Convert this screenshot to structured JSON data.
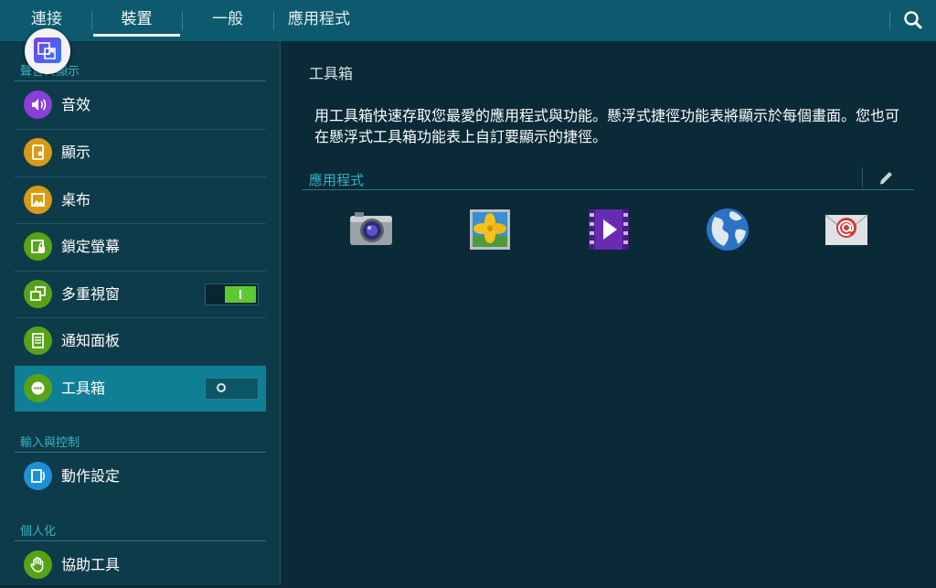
{
  "tabs": [
    {
      "label": "連接"
    },
    {
      "label": "裝置"
    },
    {
      "label": "一般"
    },
    {
      "label": "應用程式"
    }
  ],
  "active_tab": "裝置",
  "sections": [
    {
      "header": "聲音與顯示",
      "items": [
        {
          "label": "音效",
          "icon": "sound-icon",
          "color": "#8a3fd8"
        },
        {
          "label": "顯示",
          "icon": "display-icon",
          "color": "#d99a14"
        },
        {
          "label": "桌布",
          "icon": "wallpaper-icon",
          "color": "#d99a14"
        },
        {
          "label": "鎖定螢幕",
          "icon": "lock-screen-icon",
          "color": "#56a318"
        },
        {
          "label": "多重視窗",
          "icon": "multi-window-icon",
          "color": "#56a318",
          "toggle": "on"
        },
        {
          "label": "通知面板",
          "icon": "notification-panel-icon",
          "color": "#56a318"
        },
        {
          "label": "工具箱",
          "icon": "toolbox-icon",
          "color": "#56a318",
          "toggle": "off",
          "selected": true
        }
      ]
    },
    {
      "header": "輸入與控制",
      "items": [
        {
          "label": "動作設定",
          "icon": "motion-icon",
          "color": "#1d8fd8"
        }
      ]
    },
    {
      "header": "個人化",
      "items": [
        {
          "label": "協助工具",
          "icon": "accessibility-icon",
          "color": "#56a318"
        }
      ]
    }
  ],
  "detail": {
    "title": "工具箱",
    "description": "用工具箱快速存取您最愛的應用程式與功能。懸浮式捷徑功能表將顯示於每個畫面。您也可在懸浮式工具箱功能表上自訂要顯示的捷徑。",
    "apps_header": "應用程式",
    "apps": [
      {
        "icon": "camera-icon"
      },
      {
        "icon": "gallery-icon"
      },
      {
        "icon": "video-icon"
      },
      {
        "icon": "internet-icon"
      },
      {
        "icon": "email-icon"
      }
    ]
  },
  "colors": {
    "topbar": "#0d5a6e",
    "accent": "#34b3c5",
    "selected_row": "#0f7f96",
    "toggle_on": "#5cc92f"
  }
}
